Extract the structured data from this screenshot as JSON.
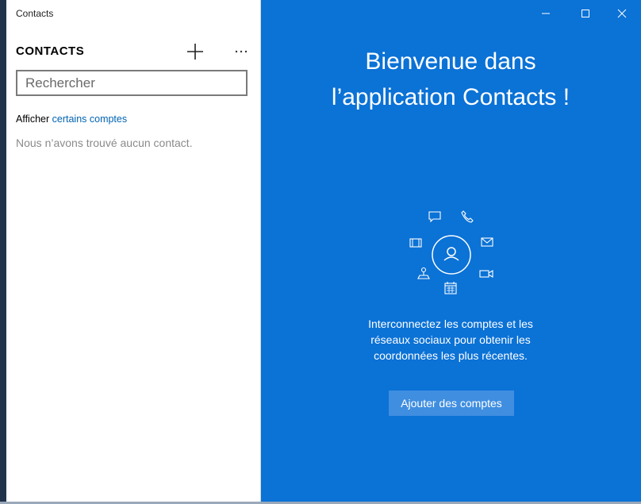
{
  "window": {
    "title": "Contacts"
  },
  "left_pane": {
    "heading": "CONTACTS",
    "add_icon": "plus-icon",
    "more_icon": "ellipsis-icon",
    "search": {
      "placeholder": "Rechercher",
      "value": ""
    },
    "filter_prefix": "Afficher ",
    "filter_link": "certains comptes",
    "empty_message": "Nous n’avons trouvé aucun contact."
  },
  "title_bar": {
    "icons": [
      "minimize-icon",
      "maximize-icon",
      "close-icon"
    ]
  },
  "welcome": {
    "title_line1": "Bienvenue dans",
    "title_line2": "l’application Contacts !",
    "description_line1": "Interconnectez les comptes et les",
    "description_line2": "réseaux sociaux pour obtenir les",
    "description_line3": "coordonnées les plus récentes.",
    "add_accounts_label": "Ajouter des comptes",
    "hero_icons": [
      "person-icon",
      "chat-icon",
      "phone-icon",
      "mail-icon",
      "video-icon",
      "calendar-icon",
      "map-icon",
      "photos-icon"
    ]
  },
  "colors": {
    "accent": "#0b72d6",
    "link": "#0063b1",
    "button": "#3f8ee0"
  }
}
